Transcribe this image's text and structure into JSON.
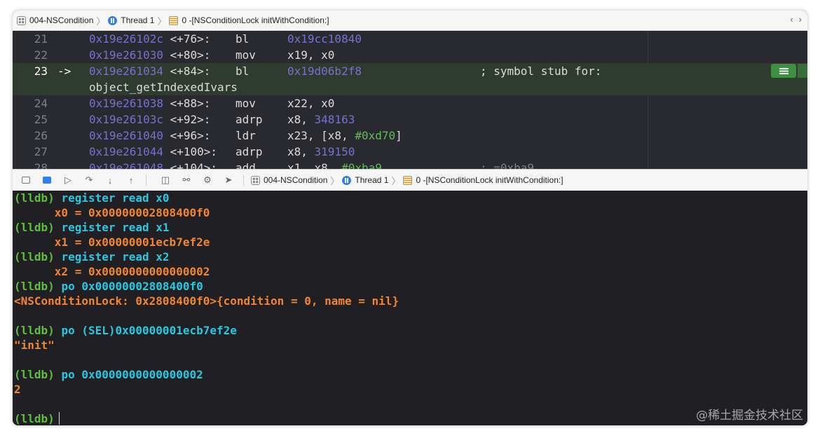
{
  "jumpbar": {
    "project": "004-NSCondition",
    "thread": "Thread 1",
    "frame": "0 -[NSConditionLock initWithCondition:]",
    "nav_back": "‹",
    "nav_forward": "›"
  },
  "disassembly": [
    {
      "line": "21",
      "address": "0x19e26102c",
      "offset": "<+76>:",
      "mnemonic": "bl",
      "operand_num": "0x19cc10840",
      "operand_text": "",
      "operand_imm": "",
      "comment": ""
    },
    {
      "line": "22",
      "address": "0x19e261030",
      "offset": "<+80>:",
      "mnemonic": "mov",
      "operand_num": "",
      "operand_text": "x19, x0",
      "operand_imm": "",
      "comment": ""
    },
    {
      "line": "23",
      "arrow": "->",
      "address": "0x19e261034",
      "offset": "<+84>:",
      "mnemonic": "bl",
      "operand_num": "0x19d06b2f8",
      "operand_text": "",
      "operand_imm": "",
      "comment": "; symbol stub for:",
      "continuation": "object_getIndexedIvars",
      "current": true
    },
    {
      "line": "24",
      "address": "0x19e261038",
      "offset": "<+88>:",
      "mnemonic": "mov",
      "operand_num": "",
      "operand_text": "x22, x0",
      "operand_imm": "",
      "comment": ""
    },
    {
      "line": "25",
      "address": "0x19e26103c",
      "offset": "<+92>:",
      "mnemonic": "adrp",
      "operand_num": "",
      "operand_text": "x8, ",
      "operand_imm": "",
      "operand_num2": "348163",
      "comment": ""
    },
    {
      "line": "26",
      "address": "0x19e261040",
      "offset": "<+96>:",
      "mnemonic": "ldr",
      "operand_num": "",
      "operand_text": "x23, [x8, ",
      "operand_imm": "#0xd70",
      "operand_tail": "]",
      "comment": ""
    },
    {
      "line": "27",
      "address": "0x19e261044",
      "offset": "<+100>:",
      "mnemonic": "adrp",
      "operand_num": "",
      "operand_text": "x8, ",
      "operand_imm": "",
      "operand_num2": "319150",
      "comment": ""
    },
    {
      "line": "28",
      "address": "0x19e261048",
      "offset": "<+104>:",
      "mnemonic": "add",
      "operand_num": "",
      "operand_text": "x1, x8, ",
      "operand_imm": "#0xba9",
      "comment": "; =0xba9"
    }
  ],
  "console": {
    "prompt": "(lldb)",
    "lines": [
      {
        "kind": "cmd",
        "text": "register read x0"
      },
      {
        "kind": "out",
        "text": "      x0 = 0x00000002808400f0"
      },
      {
        "kind": "cmd",
        "text": "register read x1"
      },
      {
        "kind": "out",
        "text": "      x1 = 0x00000001ecb7ef2e"
      },
      {
        "kind": "cmd",
        "text": "register read x2"
      },
      {
        "kind": "out",
        "text": "      x2 = 0x0000000000000002"
      },
      {
        "kind": "cmd",
        "text": "po 0x00000002808400f0"
      },
      {
        "kind": "out",
        "text": "<NSConditionLock: 0x2808400f0>{condition = 0, name = nil}"
      },
      {
        "kind": "blank",
        "text": ""
      },
      {
        "kind": "cmd",
        "text": "po (SEL)0x00000001ecb7ef2e"
      },
      {
        "kind": "out",
        "text": "\"init\""
      },
      {
        "kind": "blank",
        "text": ""
      },
      {
        "kind": "cmd",
        "text": "po 0x0000000000000002"
      },
      {
        "kind": "out",
        "text": "2"
      },
      {
        "kind": "blank",
        "text": ""
      },
      {
        "kind": "input",
        "text": ""
      }
    ]
  },
  "watermark": "@稀土掘金技术社区",
  "colors": {
    "prompt": "#5fbf3d",
    "command": "#27c8e0",
    "output": "#f0862f",
    "address": "#7d6fd1",
    "immediate": "#67b75b",
    "current_line": "#2f3b2f"
  }
}
